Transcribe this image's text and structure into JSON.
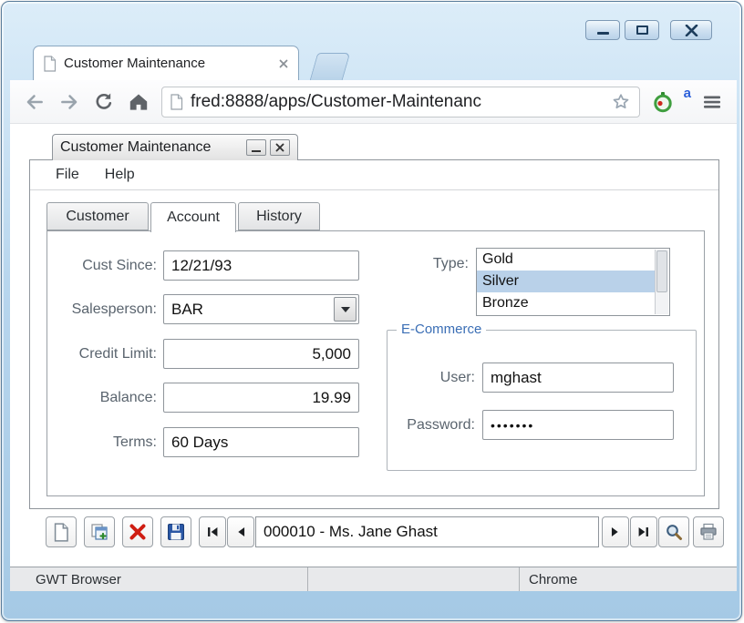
{
  "browser": {
    "tab_title": "Customer Maintenance",
    "url": "fred:8888/apps/Customer-Maintenanc",
    "extension_badge": "a"
  },
  "app": {
    "window_title": "Customer Maintenance",
    "menus": [
      {
        "label": "File"
      },
      {
        "label": "Help"
      }
    ],
    "tabs": [
      {
        "label": "Customer"
      },
      {
        "label": "Account"
      },
      {
        "label": "History"
      }
    ],
    "active_tab": "Account",
    "form": {
      "cust_since": {
        "label": "Cust Since:",
        "value": "12/21/93"
      },
      "salesperson": {
        "label": "Salesperson:",
        "value": "BAR"
      },
      "credit_limit": {
        "label": "Credit Limit:",
        "value": "5,000"
      },
      "balance": {
        "label": "Balance:",
        "value": "19.99"
      },
      "terms": {
        "label": "Terms:",
        "value": "60 Days"
      },
      "type": {
        "label": "Type:",
        "options": [
          "Gold",
          "Silver",
          "Bronze"
        ],
        "selected": "Silver"
      },
      "ecommerce": {
        "legend": "E-Commerce",
        "user": {
          "label": "User:",
          "value": "mghast"
        },
        "password": {
          "label": "Password:",
          "value": "•••••••"
        }
      }
    },
    "record_nav": {
      "current": "000010 - Ms. Jane Ghast"
    },
    "status_bar": {
      "left": "GWT Browser",
      "middle": "",
      "right": "Chrome"
    }
  },
  "colors": {
    "frame_blue": "#b8d6ee",
    "selection_blue": "#b9d1e9",
    "legend_blue": "#3a6eb5",
    "label_gray": "#5a646e"
  }
}
